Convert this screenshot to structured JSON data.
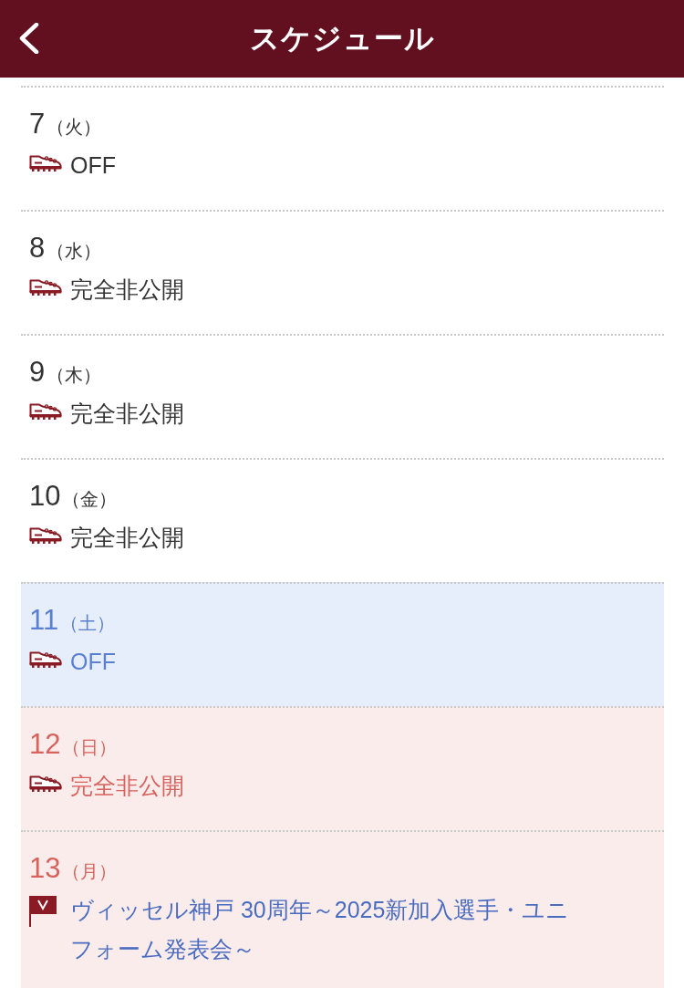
{
  "header": {
    "title": "スケジュール"
  },
  "days": [
    {
      "date": "7",
      "weekday": "（火）",
      "kind": "weekday",
      "events": [
        {
          "kind": "practice",
          "text": "OFF"
        }
      ]
    },
    {
      "date": "8",
      "weekday": "（水）",
      "kind": "weekday",
      "events": [
        {
          "kind": "practice",
          "text": "完全非公開"
        }
      ]
    },
    {
      "date": "9",
      "weekday": "（木）",
      "kind": "weekday",
      "events": [
        {
          "kind": "practice",
          "text": "完全非公開"
        }
      ]
    },
    {
      "date": "10",
      "weekday": "（金）",
      "kind": "weekday",
      "events": [
        {
          "kind": "practice",
          "text": "完全非公開"
        }
      ]
    },
    {
      "date": "11",
      "weekday": "（土）",
      "kind": "saturday",
      "events": [
        {
          "kind": "practice",
          "text": "OFF"
        }
      ]
    },
    {
      "date": "12",
      "weekday": "（日）",
      "kind": "holiday",
      "events": [
        {
          "kind": "practice",
          "text": "完全非公開"
        }
      ]
    },
    {
      "date": "13",
      "weekday": "（月）",
      "kind": "holiday",
      "events": [
        {
          "kind": "event",
          "text": "ヴィッセル神戸 30周年～2025新加入選手・ユニフォーム発表会～"
        }
      ]
    }
  ]
}
